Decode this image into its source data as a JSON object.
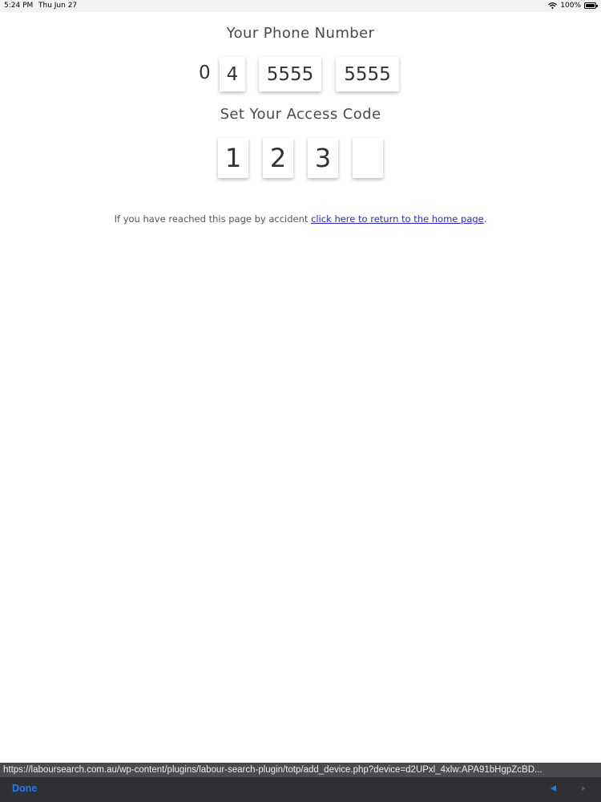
{
  "status_bar": {
    "time": "5:24 PM",
    "date": "Thu Jun 27",
    "battery": "100%",
    "icons": [
      "wifi-icon",
      "battery-icon"
    ]
  },
  "phone_section": {
    "title": "Your Phone Number",
    "prefix": "0",
    "fields": [
      {
        "value": "4"
      },
      {
        "value": "5555"
      },
      {
        "value": "5555"
      }
    ]
  },
  "code_section": {
    "title": "Set Your Access Code",
    "digits": [
      {
        "value": "1"
      },
      {
        "value": "2"
      },
      {
        "value": "3"
      },
      {
        "value": ""
      }
    ]
  },
  "notice": {
    "text": "If you have reached this page by accident ",
    "link_text": "click here to return to the home page",
    "suffix": "."
  },
  "browser": {
    "url": "https://laboursearch.com.au/wp-content/plugins/labour-search-plugin/totp/add_device.php?device=d2UPxl_4xlw:APA91bHgpZcBD...",
    "done_label": "Done",
    "accent_color": "#1c7cf4"
  }
}
